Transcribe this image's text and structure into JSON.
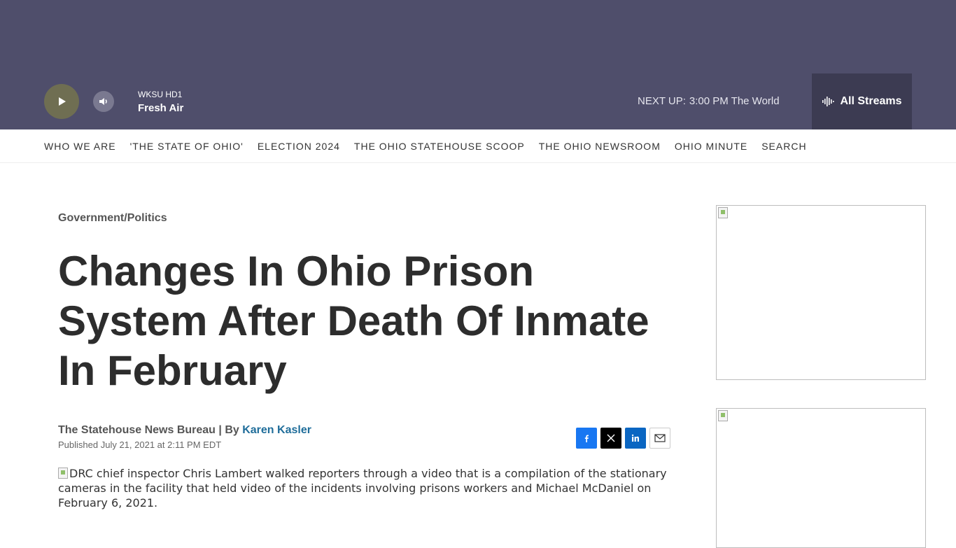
{
  "player": {
    "station_name": "WKSU HD1",
    "show_name": "Fresh Air",
    "next_up_label": "NEXT UP:",
    "next_up_text": "3:00 PM The World",
    "all_streams_label": "All Streams",
    "colors": {
      "bar": "#4f4e6b",
      "play_button": "#6f6e52",
      "streams_bg": "#3c3b52"
    }
  },
  "nav": {
    "items": [
      "WHO WE ARE",
      "'THE STATE OF OHIO'",
      "ELECTION 2024",
      "THE OHIO STATEHOUSE SCOOP",
      "THE OHIO NEWSROOM",
      "OHIO MINUTE",
      "SEARCH"
    ]
  },
  "article": {
    "category": "Government/Politics",
    "headline": "Changes In Ohio Prison System After Death Of Inmate In February",
    "byline_org": "The Statehouse News Bureau | By",
    "byline_author": "Karen Kasler",
    "published": "Published July 21, 2021 at 2:11 PM EDT",
    "image_alt": "DRC chief inspector Chris Lambert walked reporters through a video that is a compilation of the stationary cameras in the facility that held video of the incidents involving prisons workers and Michael McDaniel on February 6, 2021."
  },
  "share": {
    "icons": [
      "facebook-icon",
      "x-icon",
      "linkedin-icon",
      "email-icon"
    ],
    "colors": {
      "facebook": "#1877f2",
      "x": "#000000",
      "linkedin": "#0a66c2"
    }
  }
}
